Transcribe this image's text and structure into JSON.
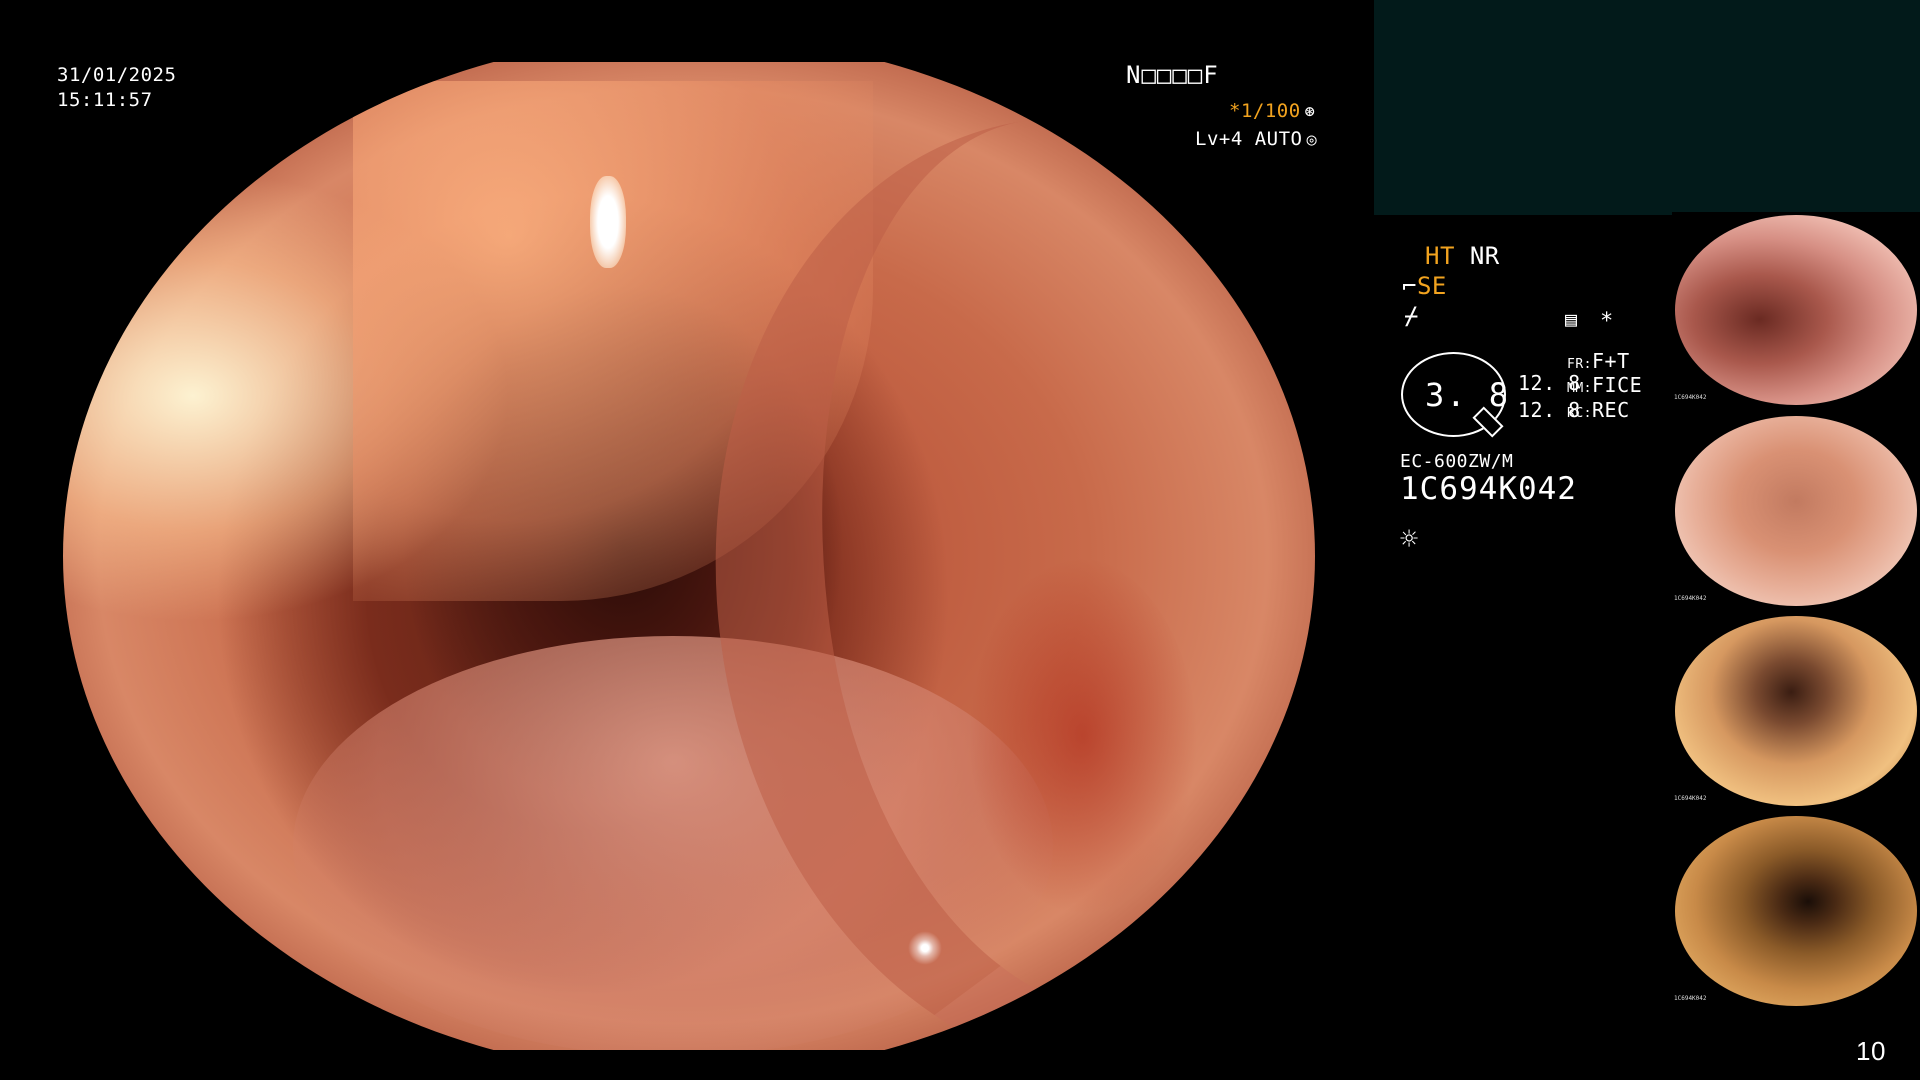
{
  "osd": {
    "date": "31/01/2025",
    "time": "15:11:57",
    "patient_code": "N□□□□F",
    "shutter": "*1/100",
    "level": "Lv+4 AUTO",
    "shutter_icon": "aperture-icon",
    "auto_icon": "target-icon"
  },
  "panel": {
    "row1": {
      "ht": "HT",
      "nr": "NR"
    },
    "row2": {
      "icon": "wrench-icon",
      "se": "SE"
    },
    "row3": {
      "icon": "lightning-icon"
    },
    "grid_icon": "grid-icon",
    "asterisk": "*",
    "dial": {
      "value": "3. 8"
    },
    "vals": [
      "12. 8",
      "12. 8"
    ],
    "modes": [
      {
        "key": "FR:",
        "val": "F+T"
      },
      {
        "key": "MM:",
        "val": "FICE"
      },
      {
        "key": "RC:",
        "val": "REC"
      }
    ],
    "scope_model": "EC-600ZW/M",
    "scope_serial": "1C694K042",
    "light_icon": "sun-icon"
  },
  "thumbnails": [
    {
      "name": "thumb-1",
      "code": "1C694K042"
    },
    {
      "name": "thumb-2",
      "code": "1C694K042"
    },
    {
      "name": "thumb-3",
      "code": "1C694K042"
    },
    {
      "name": "thumb-4",
      "code": "1C694K042"
    }
  ],
  "page_number": "10",
  "colors": {
    "accent": "#f2a31f",
    "panel_bg": "#021a1a"
  }
}
